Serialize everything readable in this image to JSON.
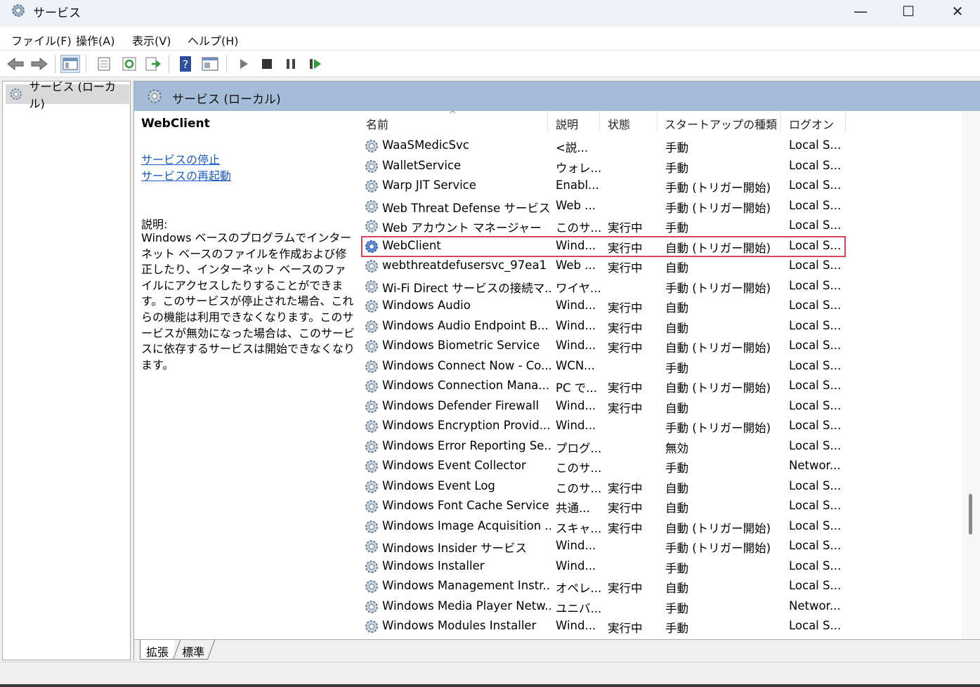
{
  "window": {
    "title": "サービス",
    "minimize": "—",
    "maximize": "☐",
    "close": "✕"
  },
  "menu": [
    "ファイル(F)",
    "操作(A)",
    "表示(V)",
    "ヘルプ(H)"
  ],
  "tree": {
    "root_label": "サービス (ローカル)"
  },
  "header": {
    "title": "サービス (ローカル)"
  },
  "detail": {
    "service_name": "WebClient",
    "stop_link": "サービスの停止",
    "restart_link": "サービスの再起動",
    "description_label": "説明:",
    "description": "Windows ベースのプログラムでインターネット ベースのファイルを作成および修正したり、インターネット ベースのファイルにアクセスしたりすることができます。このサービスが停止された場合、これらの機能は利用できなくなります。このサービスが無効になった場合は、このサービスに依存するサービスは開始できなくなります。"
  },
  "columns": {
    "name": "名前",
    "description": "説明",
    "status": "状態",
    "startup": "スタートアップの種類",
    "logon": "ログオン",
    "sort_indicator": "^"
  },
  "services": [
    {
      "name": "WaaSMedicSvc",
      "desc": "<説...",
      "status": "",
      "startup": "手動",
      "logon": "Local S..."
    },
    {
      "name": "WalletService",
      "desc": "ウォレ...",
      "status": "",
      "startup": "手動",
      "logon": "Local S..."
    },
    {
      "name": "Warp JIT Service",
      "desc": "Enabl...",
      "status": "",
      "startup": "手動 (トリガー開始)",
      "logon": "Local S..."
    },
    {
      "name": "Web Threat Defense サービス",
      "desc": "Web ...",
      "status": "",
      "startup": "手動 (トリガー開始)",
      "logon": "Local S..."
    },
    {
      "name": "Web アカウント マネージャー",
      "desc": "このサ...",
      "status": "実行中",
      "startup": "手動",
      "logon": "Local S..."
    },
    {
      "name": "WebClient",
      "desc": "Wind...",
      "status": "実行中",
      "startup": "自動 (トリガー開始)",
      "logon": "Local S...",
      "selected": true
    },
    {
      "name": "webthreatdefusersvc_97ea1",
      "desc": "Web ...",
      "status": "実行中",
      "startup": "自動",
      "logon": "Local S..."
    },
    {
      "name": "Wi-Fi Direct サービスの接続マ...",
      "desc": "ワイヤ...",
      "status": "",
      "startup": "手動 (トリガー開始)",
      "logon": "Local S..."
    },
    {
      "name": "Windows Audio",
      "desc": "Wind...",
      "status": "実行中",
      "startup": "自動",
      "logon": "Local S..."
    },
    {
      "name": "Windows Audio Endpoint B...",
      "desc": "Wind...",
      "status": "実行中",
      "startup": "自動",
      "logon": "Local S..."
    },
    {
      "name": "Windows Biometric Service",
      "desc": "Wind...",
      "status": "実行中",
      "startup": "自動 (トリガー開始)",
      "logon": "Local S..."
    },
    {
      "name": "Windows Connect Now - Co...",
      "desc": "WCN...",
      "status": "",
      "startup": "手動",
      "logon": "Local S..."
    },
    {
      "name": "Windows Connection Mana...",
      "desc": "PC で...",
      "status": "実行中",
      "startup": "自動 (トリガー開始)",
      "logon": "Local S..."
    },
    {
      "name": "Windows Defender Firewall",
      "desc": "Wind...",
      "status": "実行中",
      "startup": "自動",
      "logon": "Local S..."
    },
    {
      "name": "Windows Encryption Provid...",
      "desc": "Wind...",
      "status": "",
      "startup": "手動 (トリガー開始)",
      "logon": "Local S..."
    },
    {
      "name": "Windows Error Reporting Se...",
      "desc": "プログ...",
      "status": "",
      "startup": "無効",
      "logon": "Local S..."
    },
    {
      "name": "Windows Event Collector",
      "desc": "このサ...",
      "status": "",
      "startup": "手動",
      "logon": "Networ..."
    },
    {
      "name": "Windows Event Log",
      "desc": "このサ...",
      "status": "実行中",
      "startup": "自動",
      "logon": "Local S..."
    },
    {
      "name": "Windows Font Cache Service",
      "desc": "共通...",
      "status": "実行中",
      "startup": "自動",
      "logon": "Local S..."
    },
    {
      "name": "Windows Image Acquisition ...",
      "desc": "スキャ...",
      "status": "実行中",
      "startup": "自動 (トリガー開始)",
      "logon": "Local S..."
    },
    {
      "name": "Windows Insider サービス",
      "desc": "Wind...",
      "status": "",
      "startup": "手動 (トリガー開始)",
      "logon": "Local S..."
    },
    {
      "name": "Windows Installer",
      "desc": "Wind...",
      "status": "",
      "startup": "手動",
      "logon": "Local S..."
    },
    {
      "name": "Windows Management Instr...",
      "desc": "オペレ...",
      "status": "実行中",
      "startup": "自動",
      "logon": "Local S..."
    },
    {
      "name": "Windows Media Player Netw...",
      "desc": "ユニバ...",
      "status": "",
      "startup": "手動",
      "logon": "Networ..."
    },
    {
      "name": "Windows Modules Installer",
      "desc": "Wind...",
      "status": "実行中",
      "startup": "手動",
      "logon": "Local S..."
    }
  ],
  "bottom_tabs": {
    "extended": "拡張",
    "standard": "標準"
  },
  "icons": [
    "back-arrow-icon",
    "forward-arrow-icon",
    "show-hide-console-tree-icon",
    "properties-icon",
    "refresh-icon",
    "export-list-icon",
    "help-icon",
    "console-view-icon",
    "play-icon",
    "stop-icon",
    "pause-icon",
    "resume-icon",
    "gear-icon"
  ],
  "colors": {
    "header_bg": "#a5bcd8",
    "selection_outline": "#d9445a",
    "link": "#1a5bc4"
  }
}
